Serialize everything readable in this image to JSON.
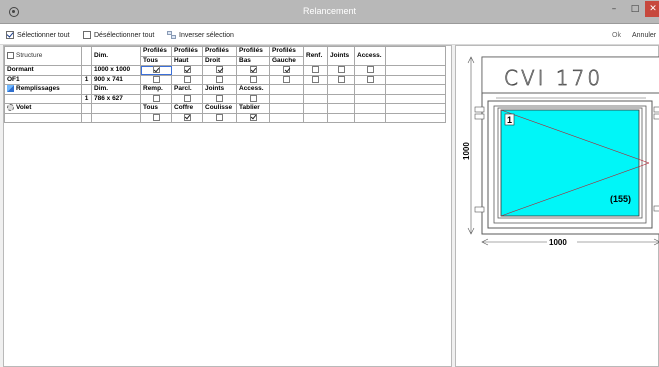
{
  "window": {
    "title": "Relancement",
    "min_glyph": "–",
    "max_glyph": "□",
    "close_glyph": "✕"
  },
  "toolbar": {
    "select_all": "Sélectionner tout",
    "deselect_all": "Désélectionner tout",
    "invert": "Inverser sélection",
    "ok": "Ok",
    "cancel": "Annuler"
  },
  "grid": {
    "header1": [
      "Structure",
      "",
      "Dim.",
      "Profilés",
      "Profilés",
      "Profilés",
      "Profilés",
      "Profilés",
      "Renf.",
      "Joints",
      "Access."
    ],
    "header2": [
      "",
      "",
      "",
      "Tous",
      "Haut",
      "Droit",
      "Bas",
      "Gauche",
      "",
      "",
      ""
    ],
    "dormant": {
      "label": "Dormant",
      "dim": "1000 x 1000",
      "checks": [
        true,
        true,
        true,
        true,
        true,
        false,
        false,
        false
      ]
    },
    "of1": {
      "label": "OF1",
      "qty": "1",
      "dim": "900 x 741",
      "checks": [
        false,
        false,
        false,
        false,
        false,
        false,
        false,
        false
      ]
    },
    "remplissages": {
      "label": "Remplissages",
      "dim_label": "Dim.",
      "cols": [
        "Remp.",
        "Parcl.",
        "Joints",
        "Access."
      ],
      "qty": "1",
      "dim": "786 x 627",
      "checks": [
        false,
        false,
        false,
        false
      ]
    },
    "volet": {
      "label": "Volet",
      "cols": [
        "Tous",
        "Coffre",
        "Coulisse",
        "Tablier"
      ],
      "checks": [
        false,
        true,
        false,
        true
      ]
    }
  },
  "preview": {
    "coffre_text": "CVI 170",
    "sash_label": "1",
    "glass_label": "(155)",
    "height_dim": "1000",
    "width_dim": "1000",
    "glass_color": "#00f6f8"
  }
}
